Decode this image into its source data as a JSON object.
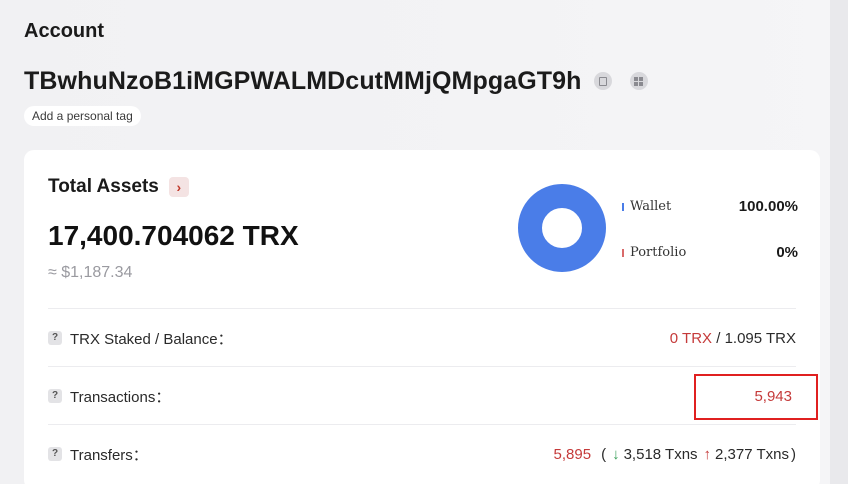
{
  "header": {
    "title": "Account",
    "address": "TBwhuNzoB1iMGPWALMDcutMMjQMpgaGT9h",
    "copy_icon": "copy-icon",
    "qr_icon": "qr-code-icon",
    "tag_label": "Add a personal tag"
  },
  "assets": {
    "label": "Total Assets",
    "arrow": "›",
    "trx_amount": "17,400.704062 TRX",
    "usd_amount": "≈ $1,187.34",
    "legend": [
      {
        "name": "Wallet",
        "value": "100.00%",
        "color": "#4a7de8"
      },
      {
        "name": "Portfolio",
        "value": "0%",
        "color": "#d96a6a"
      }
    ],
    "donut": {
      "wallet_fraction": 1.0,
      "color": "#4a7de8"
    }
  },
  "rows": {
    "staked": {
      "label": "TRX Staked / Balance：",
      "staked_value": "0 TRX",
      "sep": " / ",
      "balance_value": "1.095 TRX"
    },
    "transactions": {
      "label": "Transactions：",
      "value": "5,943"
    },
    "transfers": {
      "label": "Transfers：",
      "total": "5,895",
      "open": "(",
      "in_arrow": "↓",
      "in_value": "3,518 Txns",
      "out_arrow": "↑",
      "out_value": "2,377 Txns",
      "close": ")"
    }
  },
  "colors": {
    "accent_red": "#c53a3a",
    "accent_green": "#3aa05a",
    "wallet_blue": "#4a7de8",
    "highlight": "#e02020"
  }
}
